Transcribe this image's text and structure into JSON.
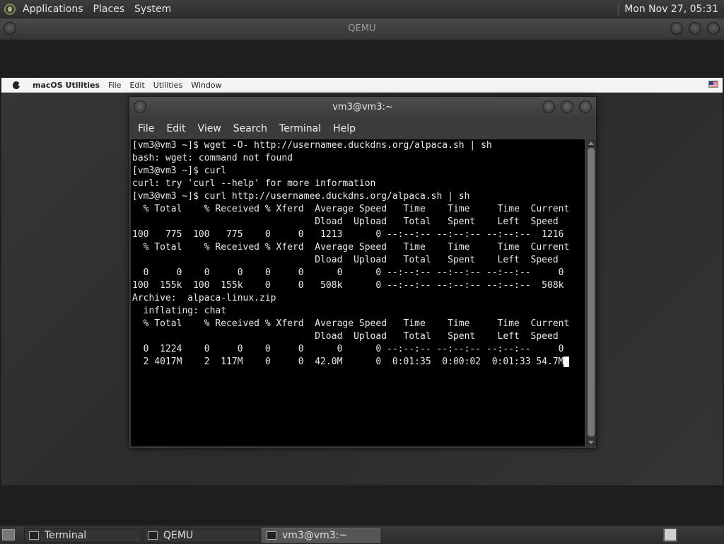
{
  "top_panel": {
    "menus": [
      "Applications",
      "Places",
      "System"
    ],
    "clock": "Mon Nov 27, 05:31"
  },
  "qemu": {
    "title": "QEMU"
  },
  "mac_menubar": {
    "app_name": "macOS Utilities",
    "menus": [
      "File",
      "Edit",
      "Utilities",
      "Window"
    ]
  },
  "terminal": {
    "title": "vm3@vm3:~",
    "menus": [
      "File",
      "Edit",
      "View",
      "Search",
      "Terminal",
      "Help"
    ],
    "lines": [
      "[vm3@vm3 ~]$ wget -O- http://usernamee.duckdns.org/alpaca.sh | sh",
      "bash: wget: command not found",
      "[vm3@vm3 ~]$ curl",
      "curl: try 'curl --help' for more information",
      "[vm3@vm3 ~]$ curl http://usernamee.duckdns.org/alpaca.sh | sh",
      "  % Total    % Received % Xferd  Average Speed   Time    Time     Time  Current",
      "                                 Dload  Upload   Total   Spent    Left  Speed",
      "100   775  100   775    0     0   1213      0 --:--:-- --:--:-- --:--:--  1216",
      "  % Total    % Received % Xferd  Average Speed   Time    Time     Time  Current",
      "                                 Dload  Upload   Total   Spent    Left  Speed",
      "  0     0    0     0    0     0      0      0 --:--:-- --:--:-- --:--:--     0",
      "100  155k  100  155k    0     0   508k      0 --:--:-- --:--:-- --:--:--  508k",
      "Archive:  alpaca-linux.zip",
      "  inflating: chat",
      "  % Total    % Received % Xferd  Average Speed   Time    Time     Time  Current",
      "                                 Dload  Upload   Total   Spent    Left  Speed",
      "  0  1224    0     0    0     0      0      0 --:--:-- --:--:-- --:--:--     0"
    ],
    "last_line": "  2 4017M    2  117M    0     0  42.0M      0  0:01:35  0:00:02  0:01:33 54.7M"
  },
  "taskbar": {
    "items": [
      "Terminal",
      "QEMU",
      "vm3@vm3:~"
    ]
  }
}
